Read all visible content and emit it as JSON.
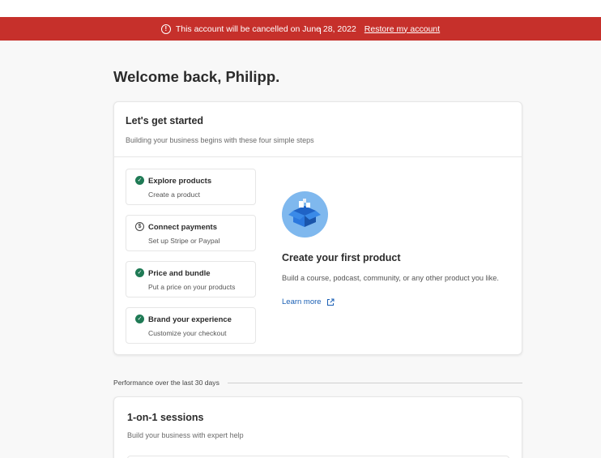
{
  "banner": {
    "message": "This account will be cancelled on June 28, 2022",
    "restore_link": "Restore my account",
    "background": "#c6302b"
  },
  "welcome": "Welcome back, Philipp.",
  "getting_started": {
    "title": "Let's get started",
    "subtitle": "Building your business begins with these four simple steps",
    "steps": [
      {
        "title": "Explore products",
        "subtitle": "Create a product",
        "status": "done",
        "icon": "check-circle-icon"
      },
      {
        "title": "Connect payments",
        "subtitle": "Set up Stripe or Paypal",
        "status": "pending",
        "icon": "dollar-circle-icon"
      },
      {
        "title": "Price and bundle",
        "subtitle": "Put a price on your products",
        "status": "done",
        "icon": "check-circle-icon"
      },
      {
        "title": "Brand your experience",
        "subtitle": "Customize your checkout",
        "status": "done",
        "icon": "check-circle-icon"
      }
    ],
    "feature": {
      "title": "Create your first product",
      "description": "Build a course, podcast, community, or any other product you like.",
      "learn_more": "Learn more"
    }
  },
  "performance_label": "Performance over the last 30 days",
  "sessions": {
    "title": "1-on-1 sessions",
    "subtitle": "Build your business with expert help"
  }
}
